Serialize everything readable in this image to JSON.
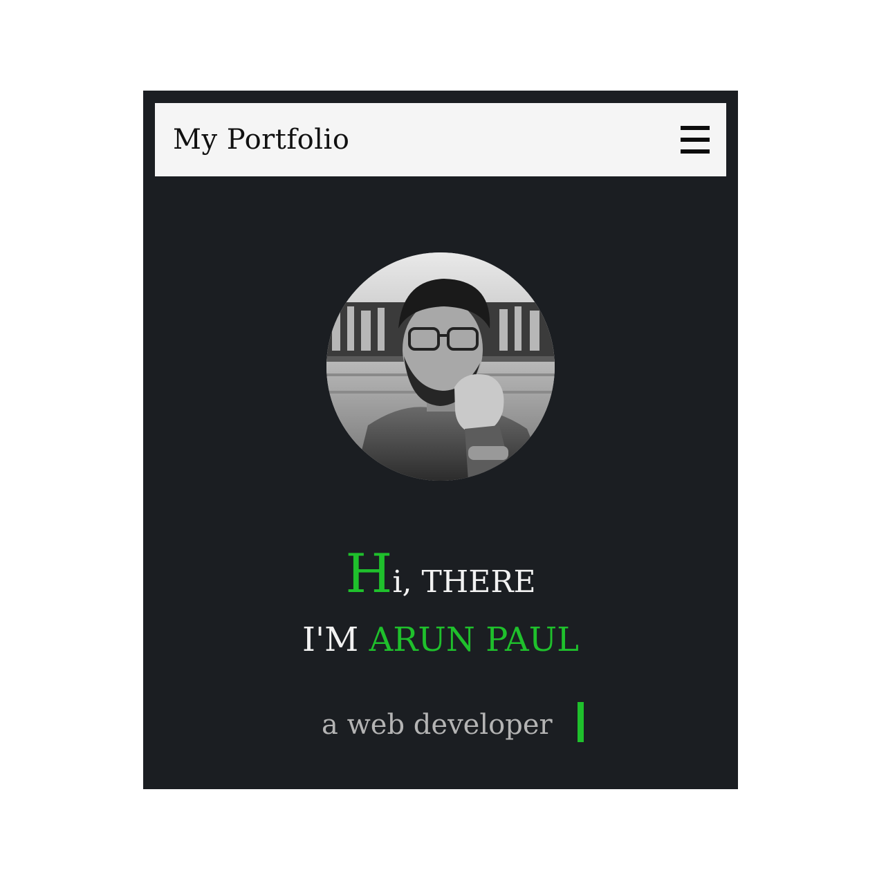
{
  "navbar": {
    "brand": "My Portfolio",
    "menu_icon": "hamburger-menu-icon"
  },
  "hero": {
    "avatar_alt": "profile photo",
    "greeting_initial": "H",
    "greeting_rest": "i, THERE",
    "intro_prefix": "I'M ",
    "name": "ARUN PAUL",
    "tagline": "a web developer"
  },
  "colors": {
    "background": "#1b1e22",
    "navbar": "#f5f5f5",
    "accent": "#1fc02c",
    "text": "#f2f2f2",
    "muted": "#b4b4b4"
  }
}
